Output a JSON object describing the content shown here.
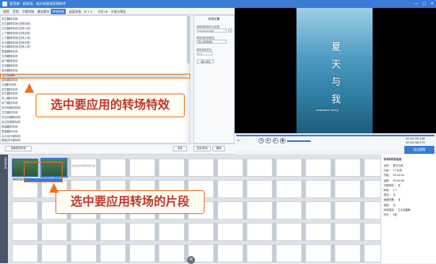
{
  "titlebar": {
    "title": "爱剪辑 - 超易用、强大的视频剪辑软件",
    "min": "—",
    "max": "□",
    "close": "✕"
  },
  "tabs": [
    "视频",
    "音频",
    "字幕特效",
    "叠加素材",
    "转场特效",
    "画面风格",
    "M T V",
    "卡拉OK",
    "升级与服务"
  ],
  "transition_list": [
    "向右翻转切换",
    "左右翻转特效(拉伸出场)",
    "左右翻转特效(拉伸入场)",
    "上下翻转特效(拉伸出场)",
    "上下翻转特效(拉伸入场)",
    "水平翻转特效(拉伸出场)",
    "水平翻转特效(拉伸入场)",
    "垂直翻转特效",
    "立体翻转特效",
    "盒子翻转特效",
    "方块翻转特效",
    "卷页翻转特效",
    "立方体翻转",
    "旋转翻转特效",
    "3D翻页特效",
    "向右翻页特效",
    "向左翻页特效",
    "向上翻页特效",
    "向下翻页特效",
    "多边形翻页特效",
    "左右翻页特效",
    "多边形翻转特效",
    "多边形缩放特效",
    "卷轴翻页特效",
    "垂直翻页特效",
    "水平百叶窗特效",
    "垂直百叶窗特效",
    "翻页特效(上下翻页)",
    "翻页特效(左右翻页)"
  ],
  "selected_index": 12,
  "settings": {
    "title": "转场设置",
    "label1": "转场特效的时长设置:",
    "value1": "00:00:01.000",
    "label2": "转场特效的属性:",
    "value2": "默认转场特效",
    "label3": "转场特效时长:",
    "value3": "0.5",
    "apply": "确认修改"
  },
  "preview": {
    "big1": "夏",
    "big2": "天",
    "big3": "与",
    "big4": "我",
    "small": "summer story"
  },
  "controls": {
    "time_current": "00:00:03.280",
    "time_total": "00:00:08.570",
    "export": "导出视频",
    "speed": "1x"
  },
  "midbar": {
    "btn1": "设置预览特效",
    "btn2": "添加",
    "btn3": "应用/修改",
    "btn4": "删除"
  },
  "timeline": {
    "side_label": "已添加片段",
    "clip1_label": "素材片段1(已添加)",
    "clip2_label": "素材片段2(已添加)",
    "empty_hint": "双击此处添加视频片段"
  },
  "info": {
    "title": "所有制作的信息：",
    "lines": [
      "名称：",
      "片段：",
      "开始：",
      "结束：",
      "字幕特效：",
      "转场：",
      "叠加：",
      "画面风格：",
      "音频：",
      "转场特效：",
      "时长："
    ],
    "values": [
      "夏天与我",
      "2个片段",
      "00:00:00",
      "00:00:08",
      "无",
      "1个",
      "无",
      "无",
      "无",
      "立方体翻转",
      "1秒"
    ]
  },
  "callouts": {
    "c1": "选中要应用的转场特效",
    "c2": "选中要应用转场的片段"
  },
  "colors": {
    "accent": "#3a7bd5",
    "callout_border": "#e8731c",
    "callout_text": "#c0392b"
  }
}
